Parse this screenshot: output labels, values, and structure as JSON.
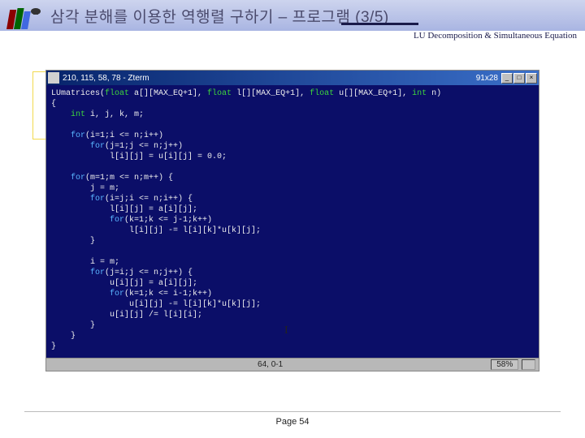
{
  "header": {
    "title": "삼각 분해를 이용한 역행렬 구하기 – 프로그램 (3/5)",
    "subtitle": "LU Decomposition & Simultaneous Equation"
  },
  "terminal": {
    "titlebar_text": "210, 115, 58, 78 - Zterm",
    "titlebar_right": "91x28",
    "btn_min": "_",
    "btn_max": "□",
    "btn_close": "×",
    "code": {
      "l0a": "LUmatrices(",
      "l0b": "float",
      "l0c": " a[][MAX_EQ+1], ",
      "l0d": "float",
      "l0e": " l[][MAX_EQ+1], ",
      "l0f": "float",
      "l0g": " u[][MAX_EQ+1], ",
      "l0h": "int",
      "l0i": " n)",
      "l1": "{",
      "l2a": "    int",
      "l2b": " i, j, k, m;",
      "l3": "",
      "l4a": "    for",
      "l4b": "(i=1;i <= n;i++)",
      "l5a": "        for",
      "l5b": "(j=1;j <= n;j++)",
      "l6": "            l[i][j] = u[i][j] = 0.0;",
      "l7": "",
      "l8a": "    for",
      "l8b": "(m=1;m <= n;m++) {",
      "l9": "        j = m;",
      "l10a": "        for",
      "l10b": "(i=j;i <= n;i++) {",
      "l11": "            l[i][j] = a[i][j];",
      "l12a": "            for",
      "l12b": "(k=1;k <= j-1;k++)",
      "l13": "                l[i][j] -= l[i][k]*u[k][j];",
      "l14": "        }",
      "l15": "",
      "l16": "        i = m;",
      "l17a": "        for",
      "l17b": "(j=i;j <= n;j++) {",
      "l18": "            u[i][j] = a[i][j];",
      "l19a": "            for",
      "l19b": "(k=1;k <= i-1;k++)",
      "l20": "                u[i][j] -= l[i][k]*u[k][j];",
      "l21": "            u[i][j] /= l[i][i];",
      "l22": "        }",
      "l23": "    }",
      "l24": "}"
    },
    "status_center": "64, 0-1",
    "status_right": "58%"
  },
  "footer": {
    "page": "Page 54"
  }
}
